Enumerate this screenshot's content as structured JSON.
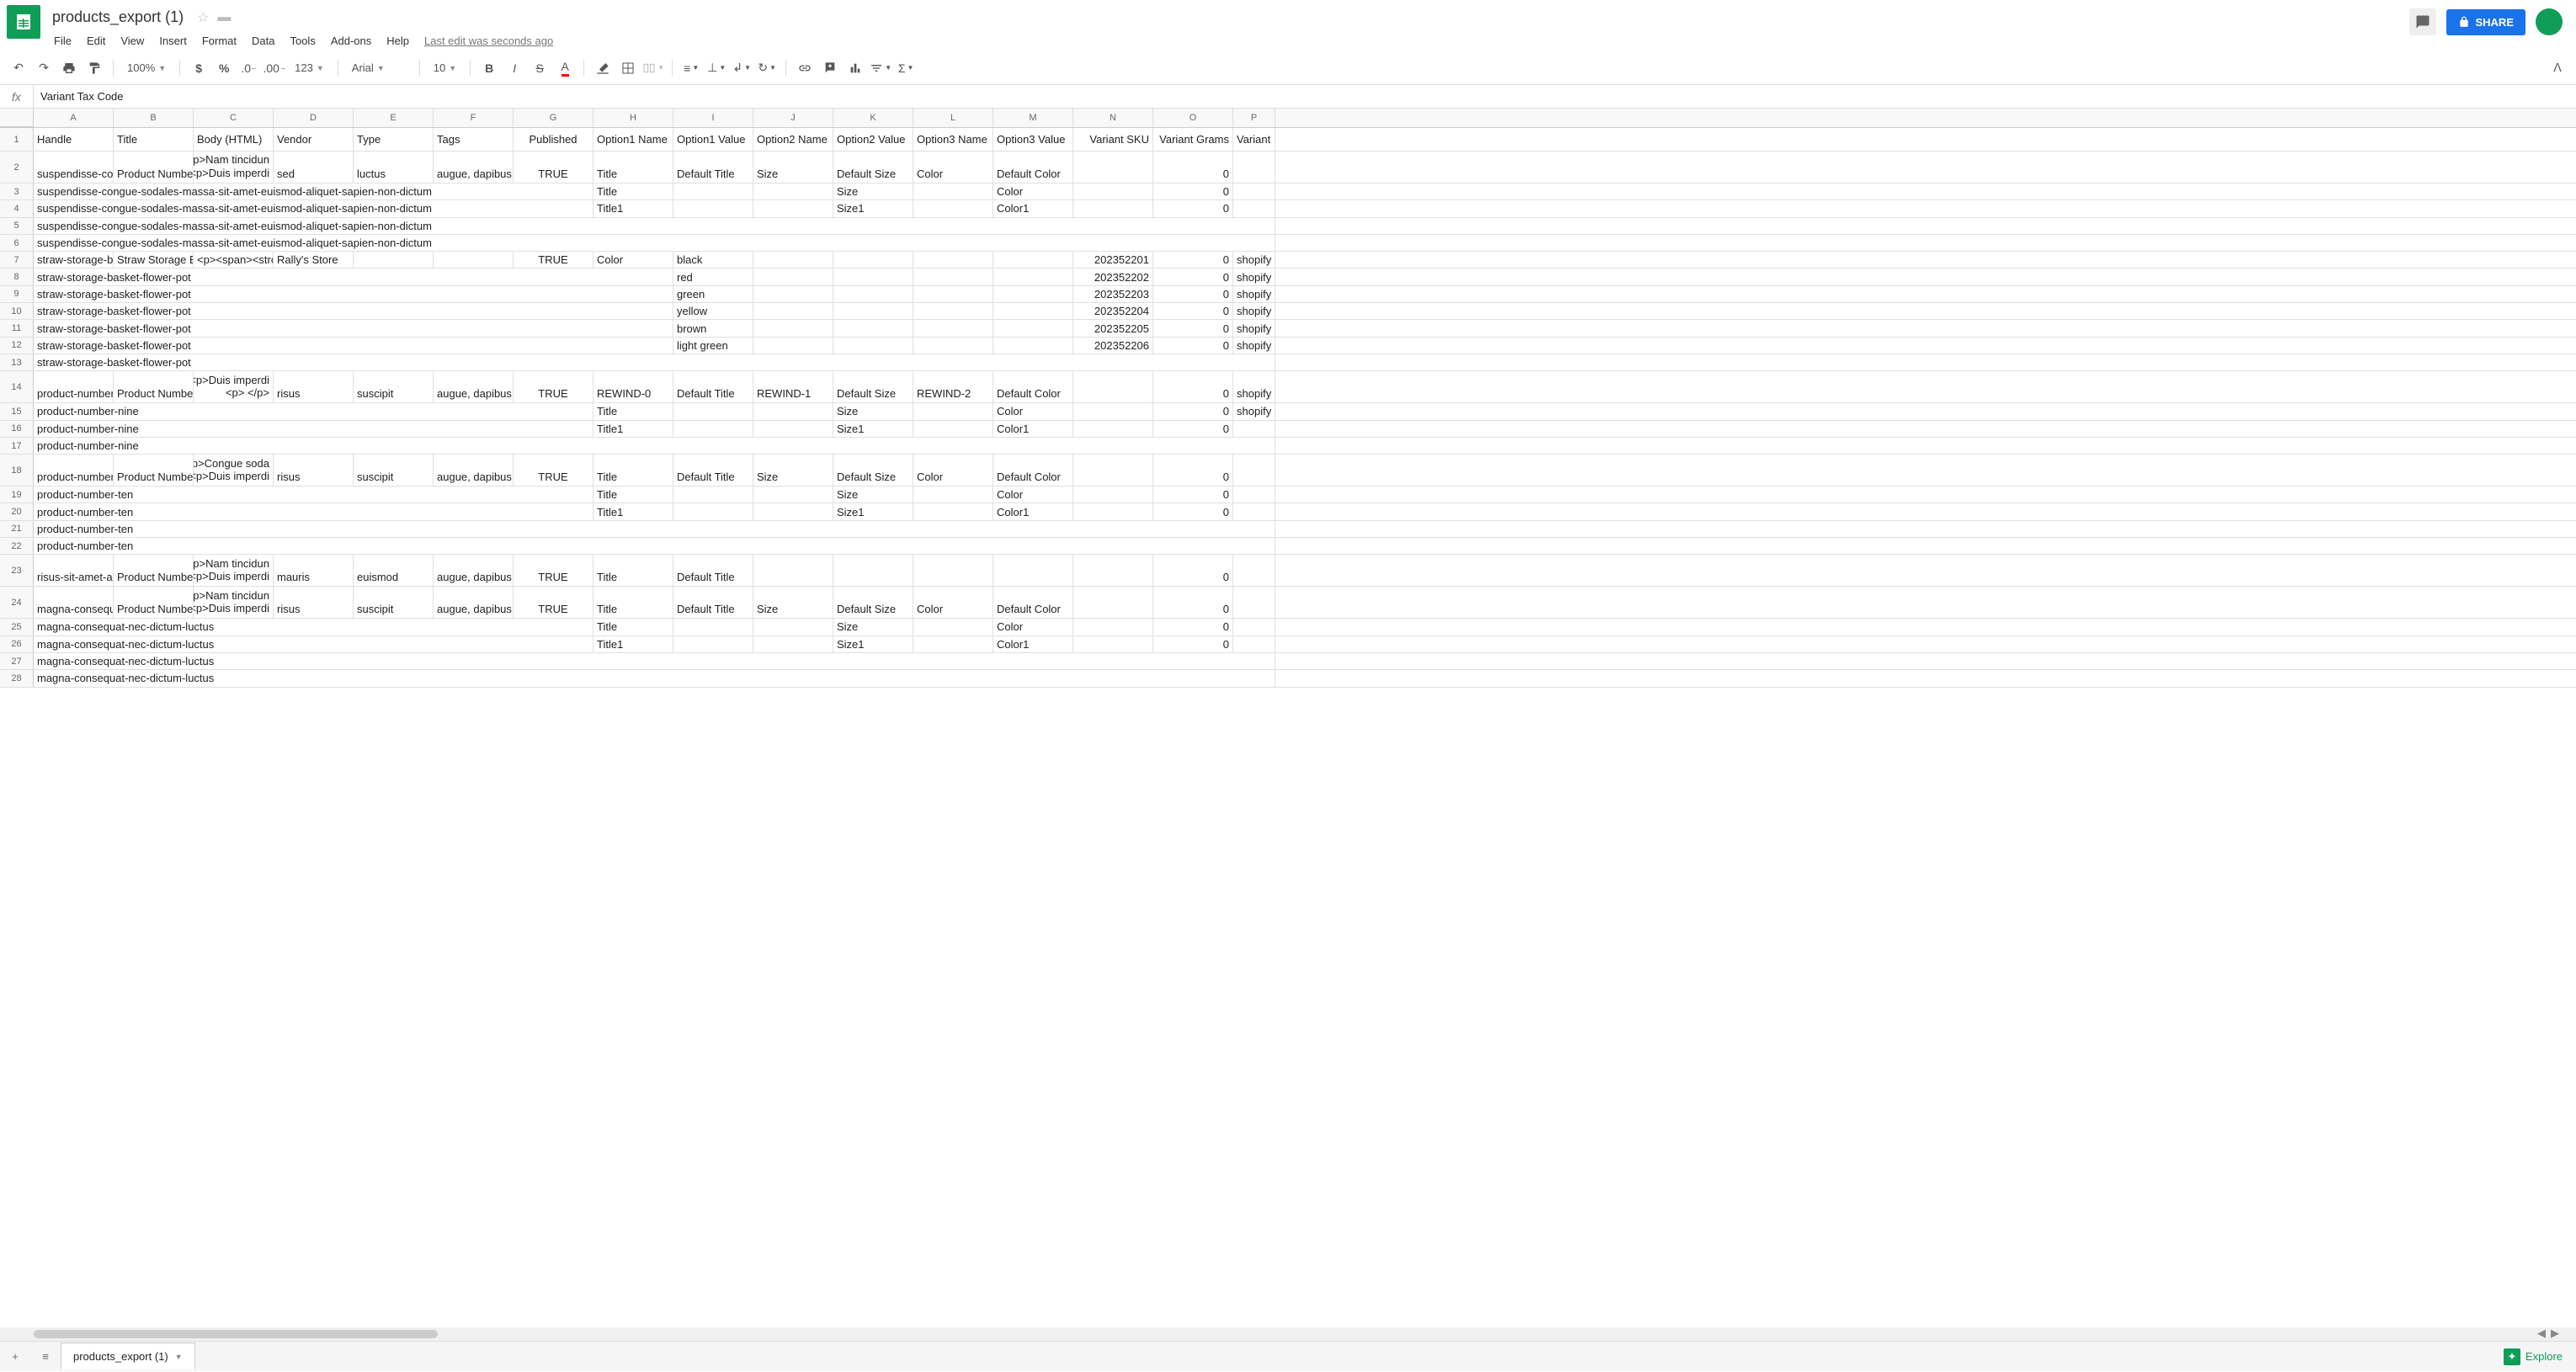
{
  "header": {
    "doc_title": "products_export (1)",
    "menus": [
      "File",
      "Edit",
      "View",
      "Insert",
      "Format",
      "Data",
      "Tools",
      "Add-ons",
      "Help"
    ],
    "last_edit": "Last edit was seconds ago",
    "share_label": "SHARE"
  },
  "toolbar": {
    "zoom": "100%",
    "font": "Arial",
    "size": "10",
    "num_fmt": "123"
  },
  "formula_bar": {
    "fx": "fx",
    "value": "Variant Tax Code"
  },
  "columns": [
    {
      "letter": "A",
      "label": "Handle",
      "width": 95
    },
    {
      "letter": "B",
      "label": "Title",
      "width": 95
    },
    {
      "letter": "C",
      "label": "Body (HTML)",
      "width": 95
    },
    {
      "letter": "D",
      "label": "Vendor",
      "width": 95
    },
    {
      "letter": "E",
      "label": "Type",
      "width": 95
    },
    {
      "letter": "F",
      "label": "Tags",
      "width": 95
    },
    {
      "letter": "G",
      "label": "Published",
      "width": 95
    },
    {
      "letter": "H",
      "label": "Option1 Name",
      "width": 95
    },
    {
      "letter": "I",
      "label": "Option1 Value",
      "width": 95
    },
    {
      "letter": "J",
      "label": "Option2 Name",
      "width": 95
    },
    {
      "letter": "K",
      "label": "Option2 Value",
      "width": 95
    },
    {
      "letter": "L",
      "label": "Option3 Name",
      "width": 95
    },
    {
      "letter": "M",
      "label": "Option3 Value",
      "width": 95
    },
    {
      "letter": "N",
      "label": "Variant SKU",
      "width": 95
    },
    {
      "letter": "O",
      "label": "Variant Grams",
      "width": 95
    },
    {
      "letter": "P",
      "label": "Variant I",
      "width": 50
    }
  ],
  "rows": [
    {
      "n": 1,
      "type": "header"
    },
    {
      "n": 2,
      "multi": true,
      "cells": {
        "A": "suspendisse-con",
        "B": "Product Number",
        "C": [
          "<p>Nam tincidun",
          "<p>Duis imperdi"
        ],
        "D": "sed",
        "E": "luctus",
        "F": "augue, dapibus,",
        "G": "TRUE",
        "H": "Title",
        "I": "Default Title",
        "J": "Size",
        "K": "Default Size",
        "L": "Color",
        "M": "Default Color",
        "O": "0"
      }
    },
    {
      "n": 3,
      "cells": {
        "A": "suspendisse-congue-sodales-massa-sit-amet-euismod-aliquet-sapien-non-dictum",
        "H": "Title",
        "K": "Size",
        "M": "Color",
        "O": "0"
      }
    },
    {
      "n": 4,
      "cells": {
        "A": "suspendisse-congue-sodales-massa-sit-amet-euismod-aliquet-sapien-non-dictum",
        "H": "Title1",
        "K": "Size1",
        "M": "Color1",
        "O": "0"
      }
    },
    {
      "n": 5,
      "cells": {
        "A": "suspendisse-congue-sodales-massa-sit-amet-euismod-aliquet-sapien-non-dictum"
      }
    },
    {
      "n": 6,
      "cells": {
        "A": "suspendisse-congue-sodales-massa-sit-amet-euismod-aliquet-sapien-non-dictum"
      }
    },
    {
      "n": 7,
      "cells": {
        "A": "straw-storage-ba",
        "B": "Straw Storage Ba",
        "C": "<p><span><stro",
        "D": "Rally's Store",
        "G": "TRUE",
        "H": "Color",
        "I": "black",
        "N": "202352201",
        "O": "0",
        "P": "shopify"
      }
    },
    {
      "n": 8,
      "cells": {
        "A": "straw-storage-basket-flower-pot",
        "I": "red",
        "N": "202352202",
        "O": "0",
        "P": "shopify"
      }
    },
    {
      "n": 9,
      "cells": {
        "A": "straw-storage-basket-flower-pot",
        "I": "green",
        "N": "202352203",
        "O": "0",
        "P": "shopify"
      }
    },
    {
      "n": 10,
      "cells": {
        "A": "straw-storage-basket-flower-pot",
        "I": "yellow",
        "N": "202352204",
        "O": "0",
        "P": "shopify"
      }
    },
    {
      "n": 11,
      "cells": {
        "A": "straw-storage-basket-flower-pot",
        "I": "brown",
        "N": "202352205",
        "O": "0",
        "P": "shopify"
      }
    },
    {
      "n": 12,
      "cells": {
        "A": "straw-storage-basket-flower-pot",
        "I": "light green",
        "N": "202352206",
        "O": "0",
        "P": "shopify"
      }
    },
    {
      "n": 13,
      "cells": {
        "A": "straw-storage-basket-flower-pot"
      }
    },
    {
      "n": 14,
      "multi": true,
      "cells": {
        "A": "product-number-",
        "B": "Product Number",
        "C": [
          "<p>Duis imperdi",
          "<p> </p>"
        ],
        "D": "risus",
        "E": "suscipit",
        "F": "augue, dapibus,",
        "G": "TRUE",
        "H": "REWIND-0",
        "I": "Default Title",
        "J": "REWIND-1",
        "K": "Default Size",
        "L": "REWIND-2",
        "M": "Default Color",
        "O": "0",
        "P": "shopify"
      }
    },
    {
      "n": 15,
      "cells": {
        "A": "product-number-nine",
        "H": "Title",
        "K": "Size",
        "M": "Color",
        "O": "0",
        "P": "shopify"
      }
    },
    {
      "n": 16,
      "cells": {
        "A": "product-number-nine",
        "H": "Title1",
        "K": "Size1",
        "M": "Color1",
        "O": "0"
      }
    },
    {
      "n": 17,
      "cells": {
        "A": "product-number-nine"
      }
    },
    {
      "n": 18,
      "multi": true,
      "cells": {
        "A": "product-number-",
        "B": "Product Number",
        "C": [
          "<p>Congue soda",
          "<p>Duis imperdi"
        ],
        "D": "risus",
        "E": "suscipit",
        "F": "augue, dapibus,",
        "G": "TRUE",
        "H": "Title",
        "I": "Default Title",
        "J": "Size",
        "K": "Default Size",
        "L": "Color",
        "M": "Default Color",
        "O": "0"
      }
    },
    {
      "n": 19,
      "cells": {
        "A": "product-number-ten",
        "H": "Title",
        "K": "Size",
        "M": "Color",
        "O": "0"
      }
    },
    {
      "n": 20,
      "cells": {
        "A": "product-number-ten",
        "H": "Title1",
        "K": "Size1",
        "M": "Color1",
        "O": "0"
      }
    },
    {
      "n": 21,
      "cells": {
        "A": "product-number-ten"
      }
    },
    {
      "n": 22,
      "cells": {
        "A": "product-number-ten"
      }
    },
    {
      "n": 23,
      "multi": true,
      "cells": {
        "A": "risus-sit-amet-an",
        "B": "Product Number",
        "C": [
          "<p>Nam tincidun",
          "<p>Duis imperdi"
        ],
        "D": "mauris",
        "E": "euismod",
        "F": "augue, dapibus,",
        "G": "TRUE",
        "H": "Title",
        "I": "Default Title",
        "O": "0"
      }
    },
    {
      "n": 24,
      "multi": true,
      "cells": {
        "A": "magna-consequa",
        "B": "Product Number",
        "C": [
          "<p>Nam tincidun",
          "<p>Duis imperdi"
        ],
        "D": "risus",
        "E": "suscipit",
        "F": "augue, dapibus,",
        "G": "TRUE",
        "H": "Title",
        "I": "Default Title",
        "J": "Size",
        "K": "Default Size",
        "L": "Color",
        "M": "Default Color",
        "O": "0"
      }
    },
    {
      "n": 25,
      "cells": {
        "A": "magna-consequat-nec-dictum-luctus",
        "H": "Title",
        "K": "Size",
        "M": "Color",
        "O": "0"
      }
    },
    {
      "n": 26,
      "cells": {
        "A": "magna-consequat-nec-dictum-luctus",
        "H": "Title1",
        "K": "Size1",
        "M": "Color1",
        "O": "0"
      }
    },
    {
      "n": 27,
      "cells": {
        "A": "magna-consequat-nec-dictum-luctus"
      }
    },
    {
      "n": 28,
      "cells": {
        "A": "magna-consequat-nec-dictum-luctus"
      }
    }
  ],
  "sheet": {
    "tab": "products_export (1)",
    "explore": "Explore"
  }
}
